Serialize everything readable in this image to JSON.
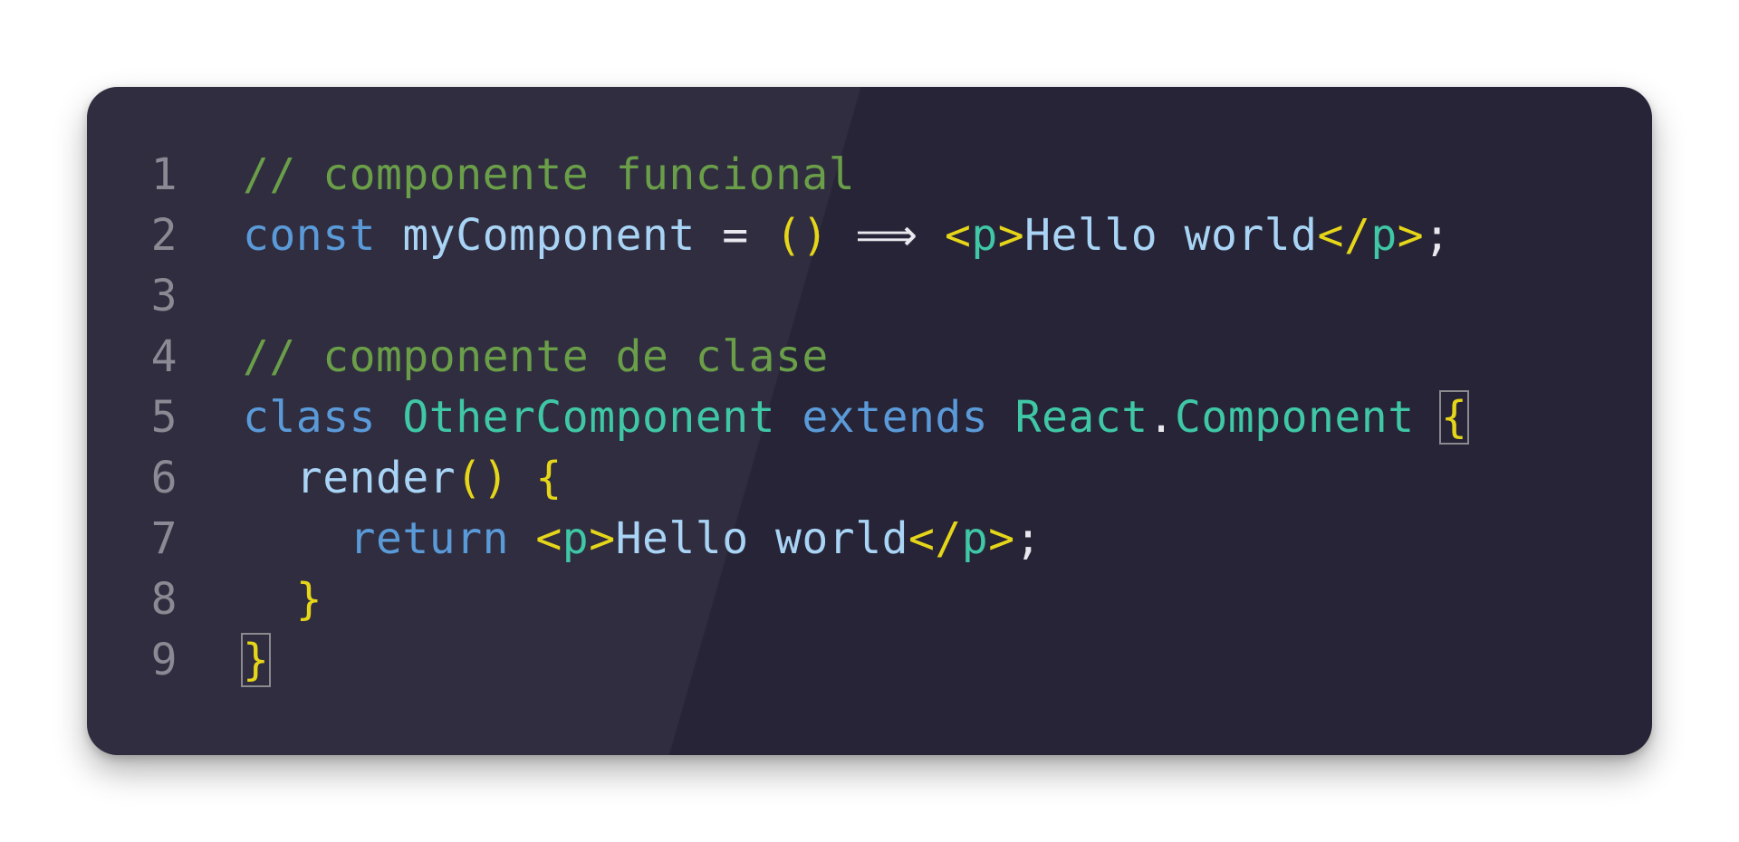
{
  "colors": {
    "background": "#ffffff",
    "editor_background": "#262436",
    "line_number": "#8b8a94",
    "comment": "#6a9e49",
    "keyword": "#5b9ad8",
    "identifier": "#a9d4f5",
    "plain": "#e8e8ee",
    "bracket": "#e6d619",
    "tag_name": "#3fc7a6",
    "class_name": "#3fc7a6",
    "bracket_match_outline": "#8a8a8f"
  },
  "line_numbers": [
    "1",
    "2",
    "3",
    "4",
    "5",
    "6",
    "7",
    "8",
    "9"
  ],
  "code": {
    "line1": {
      "comment": "// componente funcional"
    },
    "line2": {
      "kw": "const",
      "name": "myComponent",
      "eq": "=",
      "parens": "()",
      "arrow": "⟹",
      "tag_open_lt": "<",
      "tag_open_name": "p",
      "tag_open_gt": ">",
      "text": "Hello world",
      "tag_close_lt": "</",
      "tag_close_name": "p",
      "tag_close_gt": ">",
      "semicolon": ";"
    },
    "line4": {
      "comment": "// componente de clase"
    },
    "line5": {
      "kw_class": "class",
      "class_name": "OtherComponent",
      "kw_extends": "extends",
      "obj": "React",
      "dot": ".",
      "member": "Component",
      "brace_open": "{"
    },
    "line6": {
      "method": "render",
      "parens": "()",
      "brace_open": "{"
    },
    "line7": {
      "kw": "return",
      "tag_open_lt": "<",
      "tag_open_name": "p",
      "tag_open_gt": ">",
      "text": "Hello world",
      "tag_close_lt": "</",
      "tag_close_name": "p",
      "tag_close_gt": ">",
      "semicolon": ";"
    },
    "line8": {
      "brace_close": "}"
    },
    "line9": {
      "brace_close": "}"
    }
  }
}
